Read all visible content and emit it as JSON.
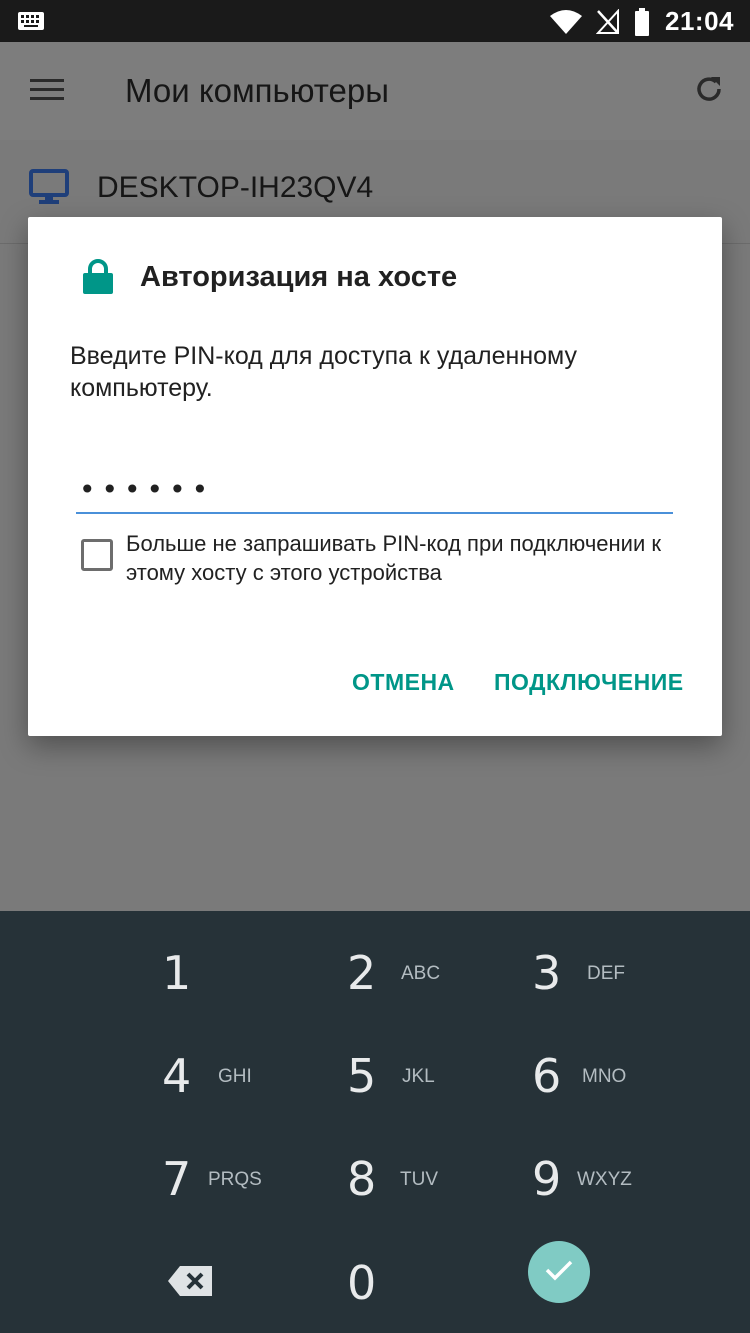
{
  "status_bar": {
    "time": "21:04",
    "icons": [
      "keyboard-icon",
      "wifi-icon",
      "no-signal-icon",
      "battery-icon"
    ]
  },
  "app_bar": {
    "title": "Мои компьютеры",
    "menu_icon": "hamburger-menu-icon",
    "refresh_icon": "refresh-icon"
  },
  "hosts": [
    {
      "name": "DESKTOP-IH23QV4",
      "icon": "monitor-icon"
    }
  ],
  "dialog": {
    "title": "Авторизация на хосте",
    "message": "Введите PIN-код для доступа к удаленному компьютеру.",
    "pin_value": "••••••",
    "remember_label": "Больше не запрашивать PIN-код при подключении к этому хосту с этого устройства",
    "remember_checked": false,
    "cancel_label": "ОТМЕНА",
    "connect_label": "ПОДКЛЮЧЕНИЕ",
    "accent_color": "#009688"
  },
  "keypad": {
    "keys": [
      {
        "num": "1",
        "letters": ""
      },
      {
        "num": "2",
        "letters": "ABC"
      },
      {
        "num": "3",
        "letters": "DEF"
      },
      {
        "num": "4",
        "letters": "GHI"
      },
      {
        "num": "5",
        "letters": "JKL"
      },
      {
        "num": "6",
        "letters": "MNO"
      },
      {
        "num": "7",
        "letters": "PRQS"
      },
      {
        "num": "8",
        "letters": "TUV"
      },
      {
        "num": "9",
        "letters": "WXYZ"
      },
      {
        "num": "0",
        "letters": ""
      }
    ],
    "backspace_icon": "backspace-icon",
    "enter_icon": "check-icon",
    "background": "#263238"
  }
}
